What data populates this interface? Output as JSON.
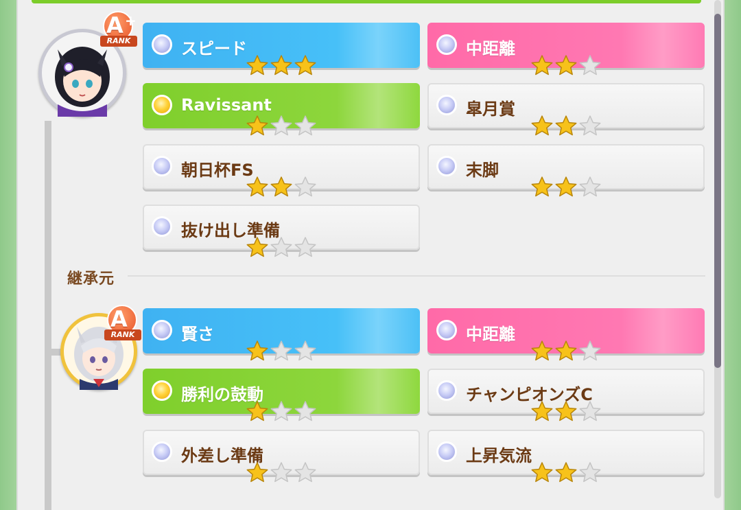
{
  "section_label": "継承元",
  "upper": {
    "rank_letter": "A",
    "rank_plus": "+",
    "rank_text": "RANK",
    "skills": [
      {
        "label": "スピード",
        "color": "blue",
        "stars": 3,
        "dot": "silver"
      },
      {
        "label": "中距離",
        "color": "pink",
        "stars": 2,
        "dot": "silver"
      },
      {
        "label": "Ravissant",
        "color": "green",
        "stars": 1,
        "dot": "gold"
      },
      {
        "label": "皐月賞",
        "color": "gray",
        "stars": 2,
        "dot": "silver"
      },
      {
        "label": "朝日杯FS",
        "color": "gray",
        "stars": 2,
        "dot": "silver"
      },
      {
        "label": "末脚",
        "color": "gray",
        "stars": 2,
        "dot": "silver"
      },
      {
        "label": "抜け出し準備",
        "color": "gray",
        "stars": 1,
        "dot": "silver"
      }
    ]
  },
  "lower": {
    "rank_letter": "A",
    "rank_text": "RANK",
    "skills": [
      {
        "label": "賢さ",
        "color": "blue",
        "stars": 1,
        "dot": "silver"
      },
      {
        "label": "中距離",
        "color": "pink",
        "stars": 2,
        "dot": "silver"
      },
      {
        "label": "勝利の鼓動",
        "color": "green",
        "stars": 1,
        "dot": "gold"
      },
      {
        "label": "チャンピオンズC",
        "color": "gray",
        "stars": 2,
        "dot": "silver"
      },
      {
        "label": "外差し準備",
        "color": "gray",
        "stars": 1,
        "dot": "silver"
      },
      {
        "label": "上昇気流",
        "color": "gray",
        "stars": 2,
        "dot": "silver"
      }
    ]
  },
  "colors": {
    "blue": "#47c0f8",
    "pink": "#ff78b2",
    "green": "#8dd63c",
    "gray": "#ececec",
    "label_brown": "#6b3a14",
    "star_gold": "#f7c21a",
    "star_empty": "#e4e4e4"
  },
  "icons": {
    "skill_dot": "skill-orb-icon",
    "star": "star-icon"
  }
}
